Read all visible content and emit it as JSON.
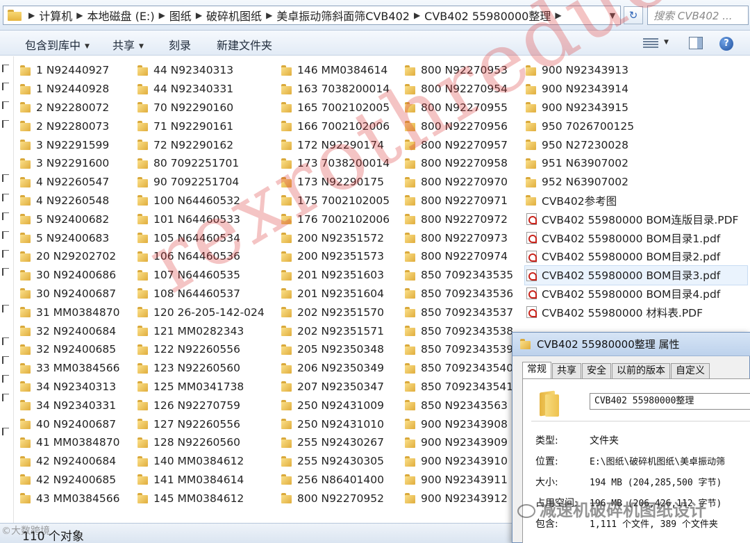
{
  "address": {
    "crumbs": [
      "计算机",
      "本地磁盘 (E:)",
      "图纸",
      "破碎机图纸",
      "美卓振动筛斜面筛CVB402",
      "CVB402 55980000整理"
    ],
    "search_placeholder": "搜索 CVB402 ..."
  },
  "toolbar": {
    "include_library": "包含到库中",
    "share": "共享",
    "burn": "刻录",
    "new_folder": "新建文件夹"
  },
  "columns": [
    [
      {
        "name": "1  N92440927",
        "type": "folder"
      },
      {
        "name": "1  N92440928",
        "type": "folder"
      },
      {
        "name": "2  N92280072",
        "type": "folder"
      },
      {
        "name": "2  N92280073",
        "type": "folder"
      },
      {
        "name": "3  N92291599",
        "type": "folder"
      },
      {
        "name": "3  N92291600",
        "type": "folder"
      },
      {
        "name": "4  N92260547",
        "type": "folder"
      },
      {
        "name": "4  N92260548",
        "type": "folder"
      },
      {
        "name": "5  N92400682",
        "type": "folder"
      },
      {
        "name": "5  N92400683",
        "type": "folder"
      },
      {
        "name": "20  N29202702",
        "type": "folder"
      },
      {
        "name": "30  N92400686",
        "type": "folder"
      },
      {
        "name": "30  N92400687",
        "type": "folder"
      },
      {
        "name": "31  MM0384870",
        "type": "folder"
      },
      {
        "name": "32  N92400684",
        "type": "folder"
      },
      {
        "name": "32  N92400685",
        "type": "folder"
      },
      {
        "name": "33  MM0384566",
        "type": "folder"
      },
      {
        "name": "34  N92340313",
        "type": "folder"
      },
      {
        "name": "34  N92340331",
        "type": "folder"
      },
      {
        "name": "40  N92400687",
        "type": "folder"
      },
      {
        "name": "41  MM0384870",
        "type": "folder"
      },
      {
        "name": "42  N92400684",
        "type": "folder"
      },
      {
        "name": "42  N92400685",
        "type": "folder"
      },
      {
        "name": "43  MM0384566",
        "type": "folder"
      }
    ],
    [
      {
        "name": "44  N92340313",
        "type": "folder"
      },
      {
        "name": "44  N92340331",
        "type": "folder"
      },
      {
        "name": "70  N92290160",
        "type": "folder"
      },
      {
        "name": "71  N92290161",
        "type": "folder"
      },
      {
        "name": "72  N92290162",
        "type": "folder"
      },
      {
        "name": "80  7092251701",
        "type": "folder"
      },
      {
        "name": "90  7092251704",
        "type": "folder"
      },
      {
        "name": "100  N64460532",
        "type": "folder"
      },
      {
        "name": "101  N64460533",
        "type": "folder"
      },
      {
        "name": "105  N64460534",
        "type": "folder"
      },
      {
        "name": "106  N64460536",
        "type": "folder"
      },
      {
        "name": "107  N64460535",
        "type": "folder"
      },
      {
        "name": "108  N64460537",
        "type": "folder"
      },
      {
        "name": "120  26-205-142-024",
        "type": "folder"
      },
      {
        "name": "121  MM0282343",
        "type": "folder"
      },
      {
        "name": "122  N92260556",
        "type": "folder"
      },
      {
        "name": "123  N92260560",
        "type": "folder"
      },
      {
        "name": "125  MM0341738",
        "type": "folder"
      },
      {
        "name": "126  N92270759",
        "type": "folder"
      },
      {
        "name": "127  N92260556",
        "type": "folder"
      },
      {
        "name": "128  N92260560",
        "type": "folder"
      },
      {
        "name": "140  MM0384612",
        "type": "folder"
      },
      {
        "name": "141  MM0384614",
        "type": "folder"
      },
      {
        "name": "145  MM0384612",
        "type": "folder"
      }
    ],
    [
      {
        "name": "146  MM0384614",
        "type": "folder"
      },
      {
        "name": "163  7038200014",
        "type": "folder"
      },
      {
        "name": "165  7002102005",
        "type": "folder"
      },
      {
        "name": "166  7002102006",
        "type": "folder"
      },
      {
        "name": "172  N92290174",
        "type": "folder"
      },
      {
        "name": "173  7038200014",
        "type": "folder"
      },
      {
        "name": "173  N92290175",
        "type": "folder"
      },
      {
        "name": "175  7002102005",
        "type": "folder"
      },
      {
        "name": "176  7002102006",
        "type": "folder"
      },
      {
        "name": "200  N92351572",
        "type": "folder"
      },
      {
        "name": "200  N92351573",
        "type": "folder"
      },
      {
        "name": "201  N92351603",
        "type": "folder"
      },
      {
        "name": "201  N92351604",
        "type": "folder"
      },
      {
        "name": "202  N92351570",
        "type": "folder"
      },
      {
        "name": "202  N92351571",
        "type": "folder"
      },
      {
        "name": "205  N92350348",
        "type": "folder"
      },
      {
        "name": "206  N92350349",
        "type": "folder"
      },
      {
        "name": "207  N92350347",
        "type": "folder"
      },
      {
        "name": "250  N92431009",
        "type": "folder"
      },
      {
        "name": "250  N92431010",
        "type": "folder"
      },
      {
        "name": "255  N92430267",
        "type": "folder"
      },
      {
        "name": "255  N92430305",
        "type": "folder"
      },
      {
        "name": "256  N86401400",
        "type": "folder"
      },
      {
        "name": "800  N92270952",
        "type": "folder"
      }
    ],
    [
      {
        "name": "800  N92270953",
        "type": "folder"
      },
      {
        "name": "800  N92270954",
        "type": "folder"
      },
      {
        "name": "800  N92270955",
        "type": "folder"
      },
      {
        "name": "800  N92270956",
        "type": "folder"
      },
      {
        "name": "800  N92270957",
        "type": "folder"
      },
      {
        "name": "800  N92270958",
        "type": "folder"
      },
      {
        "name": "800  N92270970",
        "type": "folder"
      },
      {
        "name": "800  N92270971",
        "type": "folder"
      },
      {
        "name": "800  N92270972",
        "type": "folder"
      },
      {
        "name": "800  N92270973",
        "type": "folder"
      },
      {
        "name": "800  N92270974",
        "type": "folder"
      },
      {
        "name": "850  7092343535",
        "type": "folder"
      },
      {
        "name": "850  7092343536",
        "type": "folder"
      },
      {
        "name": "850  7092343537",
        "type": "folder"
      },
      {
        "name": "850  7092343538",
        "type": "folder"
      },
      {
        "name": "850  7092343539",
        "type": "folder"
      },
      {
        "name": "850  7092343540",
        "type": "folder"
      },
      {
        "name": "850  7092343541",
        "type": "folder"
      },
      {
        "name": "850  N92343563",
        "type": "folder"
      },
      {
        "name": "900  N92343908",
        "type": "folder"
      },
      {
        "name": "900  N92343909",
        "type": "folder"
      },
      {
        "name": "900  N92343910",
        "type": "folder"
      },
      {
        "name": "900  N92343911",
        "type": "folder"
      },
      {
        "name": "900  N92343912",
        "type": "folder"
      }
    ],
    [
      {
        "name": "900  N92343913",
        "type": "folder"
      },
      {
        "name": "900  N92343914",
        "type": "folder"
      },
      {
        "name": "900  N92343915",
        "type": "folder"
      },
      {
        "name": "950  7026700125",
        "type": "folder"
      },
      {
        "name": "950  N27230028",
        "type": "folder"
      },
      {
        "name": "951  N63907002",
        "type": "folder"
      },
      {
        "name": "952  N63907002",
        "type": "folder"
      },
      {
        "name": "CVB402参考图",
        "type": "folder"
      },
      {
        "name": "CVB402 55980000 BOM连版目录.PDF",
        "type": "pdf"
      },
      {
        "name": "CVB402 55980000 BOM目录1.pdf",
        "type": "pdf"
      },
      {
        "name": "CVB402 55980000 BOM目录2.pdf",
        "type": "pdf"
      },
      {
        "name": "CVB402 55980000 BOM目录3.pdf",
        "type": "pdf",
        "selected": true
      },
      {
        "name": "CVB402 55980000 BOM目录4.pdf",
        "type": "pdf"
      },
      {
        "name": "CVB402 55980000 材料表.PDF",
        "type": "pdf"
      }
    ]
  ],
  "watermark": "rexrothreducer",
  "status": {
    "count": "110 个对象",
    "brand": "©大数跨境"
  },
  "dialog": {
    "title": "CVB402 55980000整理 属性",
    "tabs": [
      "常规",
      "共享",
      "安全",
      "以前的版本",
      "自定义"
    ],
    "folder_name": "CVB402  55980000整理",
    "props": [
      {
        "label": "类型:",
        "value": "文件夹"
      },
      {
        "label": "位置:",
        "value": "E:\\图纸\\破碎机图纸\\美卓振动筛"
      },
      {
        "label": "大小:",
        "value": "194 MB (204,285,500 字节)"
      },
      {
        "label": "占用空间:",
        "value": "196 MB (206,426,112 字节)"
      },
      {
        "label": "包含:",
        "value": "1,111 个文件, 389 个文件夹"
      }
    ]
  },
  "wechat_mark": "减速机破碎机图纸设计"
}
